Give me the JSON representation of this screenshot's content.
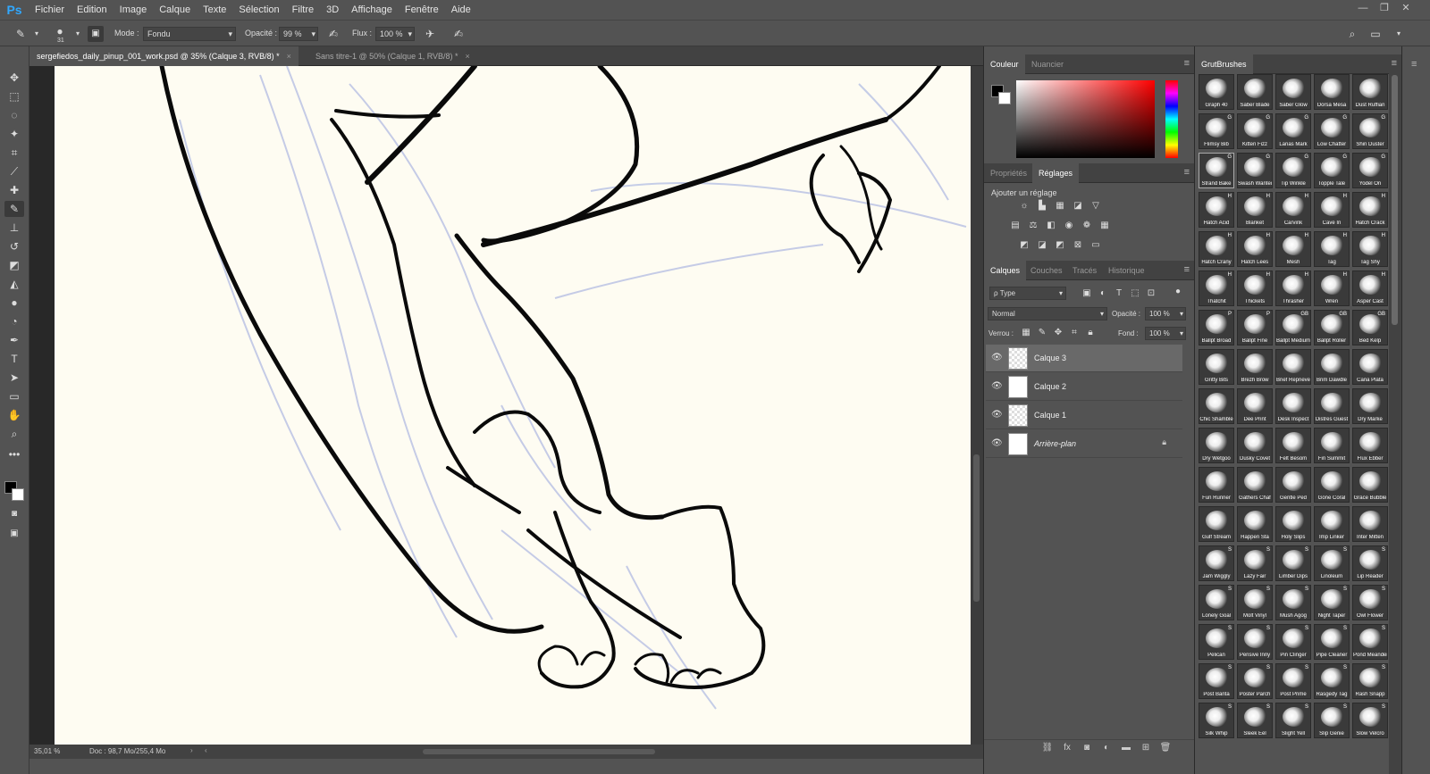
{
  "app": {
    "logo": "Ps"
  },
  "menu": [
    "Fichier",
    "Edition",
    "Image",
    "Calque",
    "Texte",
    "Sélection",
    "Filtre",
    "3D",
    "Affichage",
    "Fenêtre",
    "Aide"
  ],
  "options": {
    "brush_size": "31",
    "mode_label": "Mode :",
    "mode_value": "Fondu",
    "opacity_label": "Opacité :",
    "opacity_value": "99 %",
    "flow_label": "Flux :",
    "flow_value": "100 %"
  },
  "tabs": [
    {
      "label": "sergefiedos_daily_pinup_001_work.psd @ 35% (Calque 3, RVB/8) *",
      "close": "×"
    },
    {
      "label": "Sans titre-1 @ 50% (Calque 1, RVB/8) *",
      "close": "×"
    }
  ],
  "status": {
    "zoom": "35,01 %",
    "doc": "Doc : 98,7 Mo/255,4 Mo"
  },
  "color_panel": {
    "tabs": [
      "Couleur",
      "Nuancier"
    ],
    "foreground": "#000000",
    "background": "#ffffff"
  },
  "adjust_panel": {
    "tabs": [
      "Propriétés",
      "Réglages"
    ],
    "title": "Ajouter un réglage"
  },
  "layers_panel": {
    "tabs": [
      "Calques",
      "Couches",
      "Tracés",
      "Historique"
    ],
    "filter": "ρ Type",
    "blend_mode": "Normal",
    "opacity_label": "Opacité :",
    "opacity_value": "100 %",
    "lock_label": "Verrou :",
    "fill_label": "Fond :",
    "fill_value": "100 %",
    "layers": [
      {
        "name": "Calque 3",
        "selected": true
      },
      {
        "name": "Calque 2",
        "selected": false
      },
      {
        "name": "Calque 1",
        "selected": false
      },
      {
        "name": "Arrière-plan",
        "selected": false
      }
    ]
  },
  "brushes_panel": {
    "title": "GrutBrushes",
    "items": [
      {
        "name": "Graph 40",
        "badge": ""
      },
      {
        "name": "Saber Blade",
        "badge": ""
      },
      {
        "name": "Saber Glow",
        "badge": ""
      },
      {
        "name": "Dorsa Mesa",
        "badge": ""
      },
      {
        "name": "Dust Ruffian",
        "badge": ""
      },
      {
        "name": "Flimsy Bib",
        "badge": "G"
      },
      {
        "name": "Kitten Fizz",
        "badge": "G"
      },
      {
        "name": "Lanas Mark",
        "badge": "G"
      },
      {
        "name": "Low Chatter",
        "badge": "G"
      },
      {
        "name": "Shin Duster",
        "badge": "G"
      },
      {
        "name": "Strand Bake",
        "badge": "G"
      },
      {
        "name": "Swash Wanted",
        "badge": "G"
      },
      {
        "name": "Tip Winkle",
        "badge": "G"
      },
      {
        "name": "Topple Tale",
        "badge": "G"
      },
      {
        "name": "Yodel On",
        "badge": "G"
      },
      {
        "name": "Hatch Acid",
        "badge": "H"
      },
      {
        "name": "Blanket",
        "badge": "H"
      },
      {
        "name": "Carvink",
        "badge": "H"
      },
      {
        "name": "Cave In",
        "badge": "H"
      },
      {
        "name": "Hatch Crack",
        "badge": "H"
      },
      {
        "name": "Hatch Crany",
        "badge": "H"
      },
      {
        "name": "Hatch Lees",
        "badge": "H"
      },
      {
        "name": "Mesh",
        "badge": "H"
      },
      {
        "name": "Tag",
        "badge": "H"
      },
      {
        "name": "Tag Shy",
        "badge": "H"
      },
      {
        "name": "Thatchit",
        "badge": "H"
      },
      {
        "name": "Thickets",
        "badge": "H"
      },
      {
        "name": "Thrasher",
        "badge": "H"
      },
      {
        "name": "Wren",
        "badge": "H"
      },
      {
        "name": "Asper Cast",
        "badge": "H"
      },
      {
        "name": "Ballpt Broad",
        "badge": "P"
      },
      {
        "name": "Ballpt Fine",
        "badge": "P"
      },
      {
        "name": "Ballpt Medium",
        "badge": "GB"
      },
      {
        "name": "Ballpt Roller",
        "badge": "GB"
      },
      {
        "name": "Bed Kelp",
        "badge": "GB"
      },
      {
        "name": "Gritty Bits",
        "badge": ""
      },
      {
        "name": "Brezh Brow",
        "badge": ""
      },
      {
        "name": "Brief Reprieve",
        "badge": ""
      },
      {
        "name": "Brim Dawdle",
        "badge": ""
      },
      {
        "name": "Cana Plata",
        "badge": ""
      },
      {
        "name": "Chic Shamble",
        "badge": ""
      },
      {
        "name": "Dee Print",
        "badge": ""
      },
      {
        "name": "Desk Inspect",
        "badge": ""
      },
      {
        "name": "Distres Guest",
        "badge": ""
      },
      {
        "name": "Dry Marke",
        "badge": ""
      },
      {
        "name": "Dry Wetgoo",
        "badge": ""
      },
      {
        "name": "Dusky Covet",
        "badge": ""
      },
      {
        "name": "Felt Besom",
        "badge": ""
      },
      {
        "name": "Fin Summit",
        "badge": ""
      },
      {
        "name": "Flux Ebber",
        "badge": ""
      },
      {
        "name": "Fun Runner",
        "badge": ""
      },
      {
        "name": "Gathers Chaf",
        "badge": ""
      },
      {
        "name": "Gentle Ped",
        "badge": ""
      },
      {
        "name": "Gone Coral",
        "badge": ""
      },
      {
        "name": "Grace Bubble",
        "badge": ""
      },
      {
        "name": "Gulf Stream",
        "badge": ""
      },
      {
        "name": "Happen Sta",
        "badge": ""
      },
      {
        "name": "Holy Slips",
        "badge": ""
      },
      {
        "name": "Imp Linker",
        "badge": ""
      },
      {
        "name": "Inter Mitten",
        "badge": ""
      },
      {
        "name": "Jam Wiggly",
        "badge": "S"
      },
      {
        "name": "Lazy Fair",
        "badge": "S"
      },
      {
        "name": "Limber Dips",
        "badge": "S"
      },
      {
        "name": "Linoleum",
        "badge": "S"
      },
      {
        "name": "Lip Reader",
        "badge": "S"
      },
      {
        "name": "Lonely Goal",
        "badge": "S"
      },
      {
        "name": "Molt Vinyl",
        "badge": "S"
      },
      {
        "name": "Mush Agog",
        "badge": "S"
      },
      {
        "name": "Night Taper",
        "badge": "S"
      },
      {
        "name": "Owl Flower",
        "badge": "S"
      },
      {
        "name": "Pelican",
        "badge": "S"
      },
      {
        "name": "Pensive Inny",
        "badge": "S"
      },
      {
        "name": "Pin Clinger",
        "badge": "S"
      },
      {
        "name": "Pipe Cleaner",
        "badge": "S"
      },
      {
        "name": "Pond Meander",
        "badge": "S"
      },
      {
        "name": "Post Banta",
        "badge": "S"
      },
      {
        "name": "Poster Parch",
        "badge": "S"
      },
      {
        "name": "Post Prime",
        "badge": "S"
      },
      {
        "name": "Rasgedy Tag",
        "badge": "S"
      },
      {
        "name": "Rash Snapp",
        "badge": "S"
      },
      {
        "name": "Silk Whip",
        "badge": "S"
      },
      {
        "name": "Sleek Eel",
        "badge": "S"
      },
      {
        "name": "Slight Yell",
        "badge": "S"
      },
      {
        "name": "Slip Genie",
        "badge": "S"
      },
      {
        "name": "Slow Velcro",
        "badge": "S"
      }
    ]
  }
}
